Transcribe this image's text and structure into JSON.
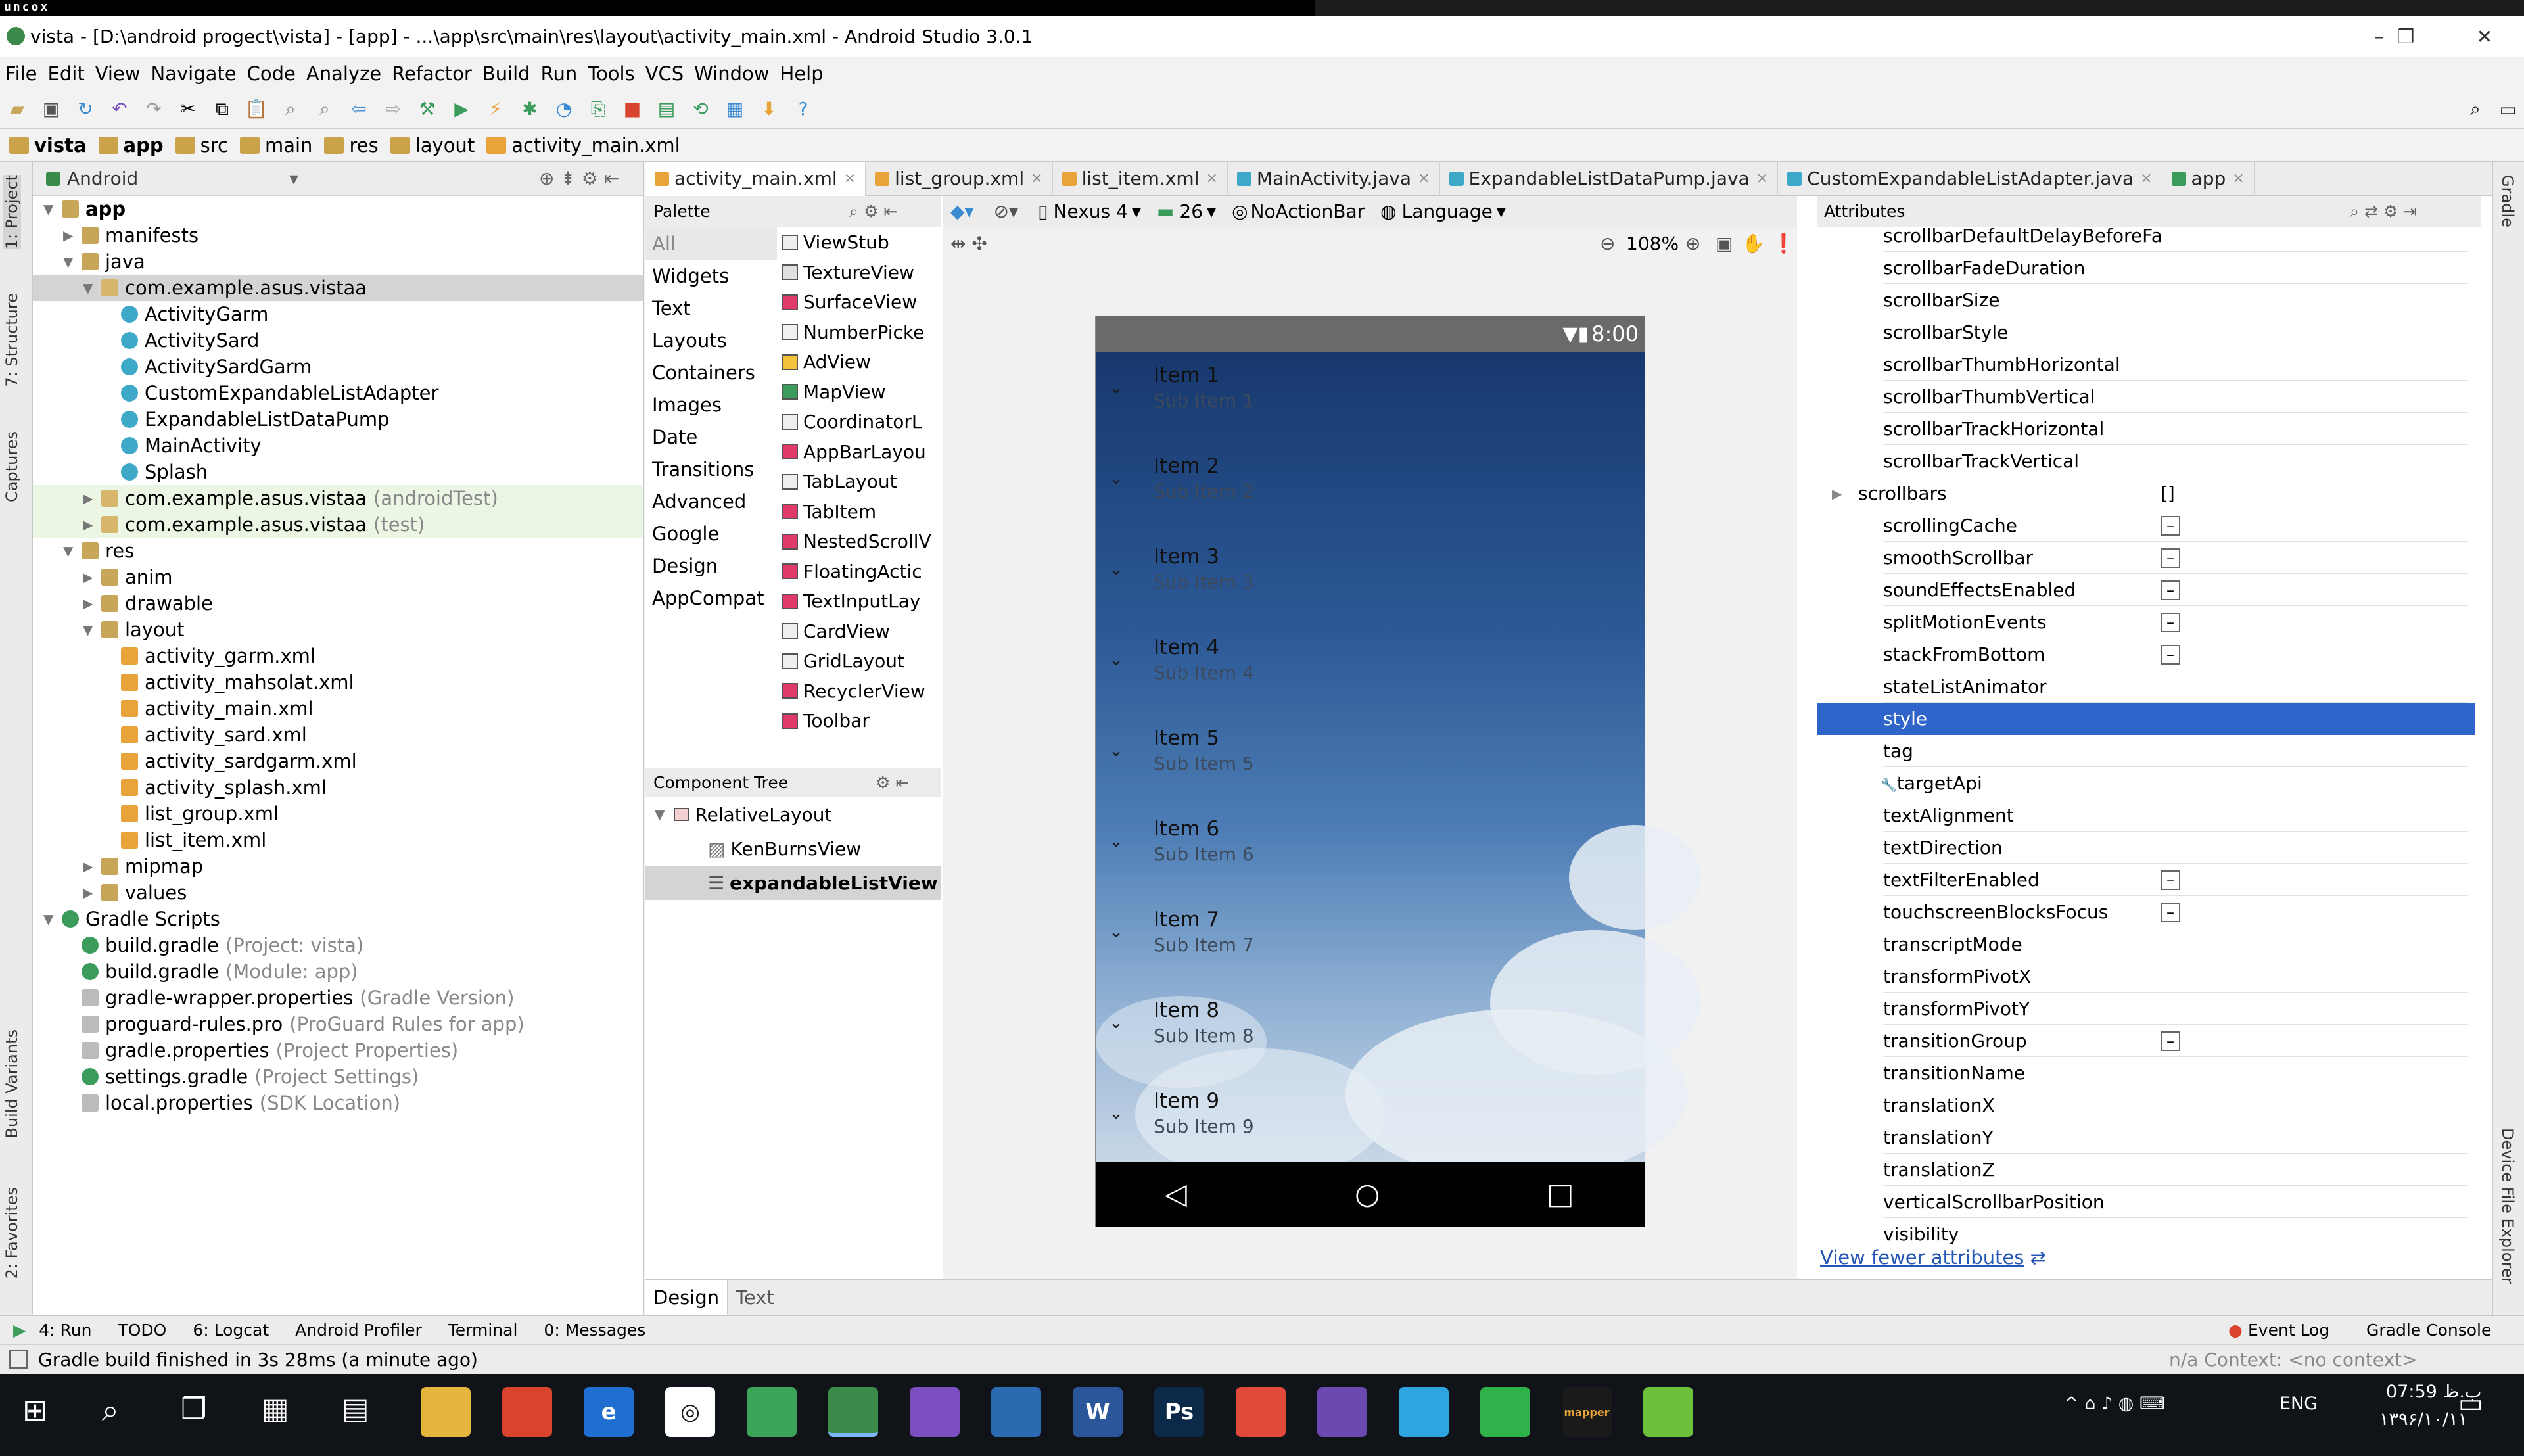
{
  "window": {
    "title": "vista - [D:\\android progect\\vista] - [app] - ...\\app\\src\\main\\res\\layout\\activity_main.xml - Android Studio 3.0.1",
    "logo": "uncox"
  },
  "menu": [
    "File",
    "Edit",
    "View",
    "Navigate",
    "Code",
    "Analyze",
    "Refactor",
    "Build",
    "Run",
    "Tools",
    "VCS",
    "Window",
    "Help"
  ],
  "breadcrumb": [
    "vista",
    "app",
    "src",
    "main",
    "res",
    "layout",
    "activity_main.xml"
  ],
  "left_tabs": [
    "1: Project",
    "7: Structure",
    "Captures",
    "Build Variants",
    "2: Favorites"
  ],
  "right_tabs": [
    "Gradle",
    "Device File Explorer"
  ],
  "project": {
    "view": "Android",
    "tree": [
      {
        "label": "app",
        "level": 0,
        "icon": "fold",
        "bold": true
      },
      {
        "label": "manifests",
        "level": 1,
        "icon": "fold"
      },
      {
        "label": "java",
        "level": 1,
        "icon": "fold"
      },
      {
        "label": "com.example.asus.vistaa",
        "level": 2,
        "icon": "pkg",
        "sel": true
      },
      {
        "label": "ActivityGarm",
        "level": 3,
        "icon": "cls"
      },
      {
        "label": "ActivitySard",
        "level": 3,
        "icon": "cls"
      },
      {
        "label": "ActivitySardGarm",
        "level": 3,
        "icon": "cls"
      },
      {
        "label": "CustomExpandableListAdapter",
        "level": 3,
        "icon": "cls"
      },
      {
        "label": "ExpandableListDataPump",
        "level": 3,
        "icon": "cls"
      },
      {
        "label": "MainActivity",
        "level": 3,
        "icon": "cls"
      },
      {
        "label": "Splash",
        "level": 3,
        "icon": "cls"
      },
      {
        "label": "com.example.asus.vistaa",
        "level": 2,
        "icon": "pkg",
        "note": "(androidTest)",
        "hl": true
      },
      {
        "label": "com.example.asus.vistaa",
        "level": 2,
        "icon": "pkg",
        "note": "(test)",
        "hl": true
      },
      {
        "label": "res",
        "level": 1,
        "icon": "fold"
      },
      {
        "label": "anim",
        "level": 2,
        "icon": "fold"
      },
      {
        "label": "drawable",
        "level": 2,
        "icon": "fold"
      },
      {
        "label": "layout",
        "level": 2,
        "icon": "fold"
      },
      {
        "label": "activity_garm.xml",
        "level": 3,
        "icon": "xml"
      },
      {
        "label": "activity_mahsolat.xml",
        "level": 3,
        "icon": "xml"
      },
      {
        "label": "activity_main.xml",
        "level": 3,
        "icon": "xml"
      },
      {
        "label": "activity_sard.xml",
        "level": 3,
        "icon": "xml"
      },
      {
        "label": "activity_sardgarm.xml",
        "level": 3,
        "icon": "xml"
      },
      {
        "label": "activity_splash.xml",
        "level": 3,
        "icon": "xml"
      },
      {
        "label": "list_group.xml",
        "level": 3,
        "icon": "xml"
      },
      {
        "label": "list_item.xml",
        "level": 3,
        "icon": "xml"
      },
      {
        "label": "mipmap",
        "level": 2,
        "icon": "fold"
      },
      {
        "label": "values",
        "level": 2,
        "icon": "fold"
      },
      {
        "label": "Gradle Scripts",
        "level": 0,
        "icon": "grad"
      },
      {
        "label": "build.gradle",
        "level": 1,
        "icon": "grad",
        "note": "(Project: vista)"
      },
      {
        "label": "build.gradle",
        "level": 1,
        "icon": "grad",
        "note": "(Module: app)"
      },
      {
        "label": "gradle-wrapper.properties",
        "level": 1,
        "icon": "file",
        "note": "(Gradle Version)"
      },
      {
        "label": "proguard-rules.pro",
        "level": 1,
        "icon": "file",
        "note": "(ProGuard Rules for app)"
      },
      {
        "label": "gradle.properties",
        "level": 1,
        "icon": "file",
        "note": "(Project Properties)"
      },
      {
        "label": "settings.gradle",
        "level": 1,
        "icon": "grad",
        "note": "(Project Settings)"
      },
      {
        "label": "local.properties",
        "level": 1,
        "icon": "file",
        "note": "(SDK Location)"
      }
    ]
  },
  "tabs": [
    {
      "label": "activity_main.xml",
      "active": true,
      "color": "#e8a33a"
    },
    {
      "label": "list_group.xml",
      "color": "#e8a33a"
    },
    {
      "label": "list_item.xml",
      "color": "#e8a33a"
    },
    {
      "label": "MainActivity.java",
      "color": "#3ea8c8"
    },
    {
      "label": "ExpandableListDataPump.java",
      "color": "#3ea8c8"
    },
    {
      "label": "CustomExpandableListAdapter.java",
      "color": "#3ea8c8"
    },
    {
      "label": "app",
      "color": "#3a9b5a"
    }
  ],
  "palette": {
    "title": "Palette",
    "categories": [
      "All",
      "Widgets",
      "Text",
      "Layouts",
      "Containers",
      "Images",
      "Date",
      "Transitions",
      "Advanced",
      "Google",
      "Design",
      "AppCompat"
    ],
    "items": [
      "ViewStub",
      "TextureView",
      "SurfaceView",
      "NumberPicke",
      "AdView",
      "MapView",
      "CoordinatorL",
      "AppBarLayou",
      "TabLayout",
      "TabItem",
      "NestedScrollV",
      "FloatingActic",
      "TextInputLay",
      "CardView",
      "GridLayout",
      "RecyclerView",
      "Toolbar"
    ]
  },
  "component_tree": {
    "title": "Component Tree",
    "items": [
      "RelativeLayout",
      "KenBurnsView",
      "expandableListView"
    ]
  },
  "canvas_toolbar": {
    "device": "Nexus 4",
    "api": "26",
    "theme": "NoActionBar",
    "language": "Language",
    "zoom": "108%"
  },
  "phone": {
    "time": "8:00",
    "items": [
      {
        "title": "Item 1",
        "sub": "Sub Item 1"
      },
      {
        "title": "Item 2",
        "sub": "Sub Item 2"
      },
      {
        "title": "Item 3",
        "sub": "Sub Item 3"
      },
      {
        "title": "Item 4",
        "sub": "Sub Item 4"
      },
      {
        "title": "Item 5",
        "sub": "Sub Item 5"
      },
      {
        "title": "Item 6",
        "sub": "Sub Item 6"
      },
      {
        "title": "Item 7",
        "sub": "Sub Item 7"
      },
      {
        "title": "Item 8",
        "sub": "Sub Item 8"
      },
      {
        "title": "Item 9",
        "sub": "Sub Item 9"
      }
    ]
  },
  "attributes": {
    "title": "Attributes",
    "rows": [
      {
        "name": "scrollbarDefaultDelayBeforeFa"
      },
      {
        "name": "scrollbarFadeDuration"
      },
      {
        "name": "scrollbarSize"
      },
      {
        "name": "scrollbarStyle"
      },
      {
        "name": "scrollbarThumbHorizontal"
      },
      {
        "name": "scrollbarThumbVertical"
      },
      {
        "name": "scrollbarTrackHorizontal"
      },
      {
        "name": "scrollbarTrackVertical"
      },
      {
        "name": "scrollbars",
        "group": true,
        "value": "[]"
      },
      {
        "name": "scrollingCache",
        "cb": true
      },
      {
        "name": "smoothScrollbar",
        "cb": true
      },
      {
        "name": "soundEffectsEnabled",
        "cb": true
      },
      {
        "name": "splitMotionEvents",
        "cb": true
      },
      {
        "name": "stackFromBottom",
        "cb": true
      },
      {
        "name": "stateListAnimator"
      },
      {
        "name": "style",
        "hl": true
      },
      {
        "name": "tag"
      },
      {
        "name": "targetApi",
        "wrench": true
      },
      {
        "name": "textAlignment"
      },
      {
        "name": "textDirection"
      },
      {
        "name": "textFilterEnabled",
        "cb": true
      },
      {
        "name": "touchscreenBlocksFocus",
        "cb": true
      },
      {
        "name": "transcriptMode"
      },
      {
        "name": "transformPivotX"
      },
      {
        "name": "transformPivotY"
      },
      {
        "name": "transitionGroup",
        "cb": true
      },
      {
        "name": "transitionName"
      },
      {
        "name": "translationX"
      },
      {
        "name": "translationY"
      },
      {
        "name": "translationZ"
      },
      {
        "name": "verticalScrollbarPosition"
      },
      {
        "name": "visibility"
      }
    ],
    "link": "View fewer attributes"
  },
  "design_tabs": [
    "Design",
    "Text"
  ],
  "bottom_tools_left": [
    "4: Run",
    "TODO",
    "6: Logcat",
    "Android Profiler",
    "Terminal",
    "0: Messages"
  ],
  "bottom_tools_right": [
    "Event Log",
    "Gradle Console"
  ],
  "status": {
    "message": "Gradle build finished in 3s 28ms (a minute ago)",
    "right": "n/a  Context: <no context>"
  },
  "taskbar": {
    "apps": [
      {
        "icon": "file-explorer-icon",
        "color": "#e6b53d",
        "label": ""
      },
      {
        "icon": "chrome-icon",
        "color": "#d9442f",
        "label": ""
      },
      {
        "icon": "edge-icon",
        "color": "#1f6fd1",
        "label": "e"
      },
      {
        "icon": "media-icon",
        "color": "#ffffff",
        "label": "◎"
      },
      {
        "icon": "globe-icon",
        "color": "#3aa557",
        "label": ""
      },
      {
        "icon": "android-studio-icon",
        "color": "#3b8a4a",
        "label": ""
      },
      {
        "icon": "visual-studio-icon",
        "color": "#7b4fc0",
        "label": ""
      },
      {
        "icon": "app-icon",
        "color": "#2a6ab0",
        "label": ""
      },
      {
        "icon": "word-icon",
        "color": "#2b579a",
        "label": "W"
      },
      {
        "icon": "photoshop-icon",
        "color": "#0b2a4a",
        "label": "Ps"
      },
      {
        "icon": "app-red-icon",
        "color": "#e04a3a",
        "label": ""
      },
      {
        "icon": "visual-code-icon",
        "color": "#6a4ab0",
        "label": ""
      },
      {
        "icon": "telegram-icon",
        "color": "#2ca5e0",
        "label": ""
      },
      {
        "icon": "whatsapp-icon",
        "color": "#2fb24a",
        "label": ""
      },
      {
        "icon": "mapper-icon",
        "color": "#1a1a1a",
        "label": "mapper"
      },
      {
        "icon": "app-green-icon",
        "color": "#6cbf3a",
        "label": ""
      }
    ],
    "lang": "ENG",
    "time": "07:59 ب.ظ",
    "date": "۱۳۹۶/۱۰/۱۱"
  },
  "colors": {
    "accent": "#2f65ca",
    "brand": "#3b8a4a"
  }
}
